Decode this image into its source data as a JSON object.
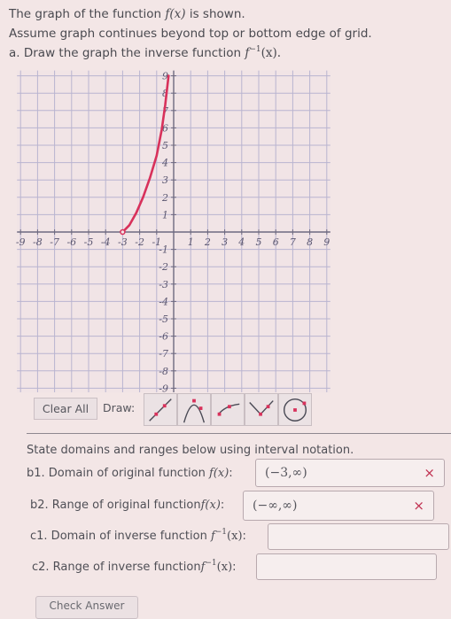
{
  "prompt": {
    "line1_pre": "The graph of the function ",
    "line1_fn": "f(x)",
    "line1_post": " is shown.",
    "line2": "Assume graph continues beyond top or bottom edge of grid.",
    "line3_pre": "a. Draw the graph the inverse function ",
    "line3_fn": "f",
    "line3_sup": "−1",
    "line3_arg": "(x)."
  },
  "graph": {
    "x_ticks": [
      "-9",
      "-8",
      "-7",
      "-6",
      "-5",
      "-4",
      "-3",
      "-2",
      "-1",
      "1",
      "2",
      "3",
      "4",
      "5",
      "6",
      "7",
      "8",
      "9"
    ],
    "y_ticks": [
      "9",
      "8",
      "7",
      "6",
      "5",
      "4",
      "3",
      "2",
      "1",
      "-1",
      "-2",
      "-3",
      "-4",
      "-5",
      "-6",
      "-7",
      "-8",
      "-9"
    ],
    "xlim": [
      -9,
      9
    ],
    "ylim": [
      -9,
      9
    ],
    "curve_color": "#d8315b",
    "curve_start": {
      "x": -3,
      "y": 0,
      "open": true
    },
    "curve_points": [
      [
        -3,
        0
      ],
      [
        -2.6,
        0.4
      ],
      [
        -2.2,
        1.1
      ],
      [
        -1.8,
        2.0
      ],
      [
        -1.4,
        3.1
      ],
      [
        -1.0,
        4.4
      ],
      [
        -0.7,
        5.9
      ],
      [
        -0.5,
        7.3
      ],
      [
        -0.3,
        9.0
      ]
    ]
  },
  "toolbar": {
    "clear_all": "Clear All",
    "draw_label": "Draw:",
    "tools": [
      "line-tool",
      "parabola-tool",
      "sqrt-curve-tool",
      "absolute-value-tool",
      "circle-tool"
    ]
  },
  "questions": {
    "instructions": "State domains and ranges below using interval notation.",
    "b1": {
      "label": "b1. Domain of original function ",
      "fn": "f(x)",
      "colon": ":",
      "value": "(−3,∞)",
      "status": "incorrect"
    },
    "b2": {
      "label": "b2. Range of original function",
      "fn": "f(x)",
      "colon": ":",
      "value": "(−∞,∞)",
      "status": "incorrect"
    },
    "c1": {
      "label": "c1. Domain of inverse function ",
      "fn": "f",
      "sup": "−1",
      "arg": "(x)",
      "colon": ":",
      "value": ""
    },
    "c2": {
      "label": "c2. Range of inverse function",
      "fn": "f",
      "sup": "−1",
      "arg": "(x)",
      "colon": ":",
      "value": ""
    },
    "wrong_mark": "×"
  },
  "check_answer": "Check Answer"
}
